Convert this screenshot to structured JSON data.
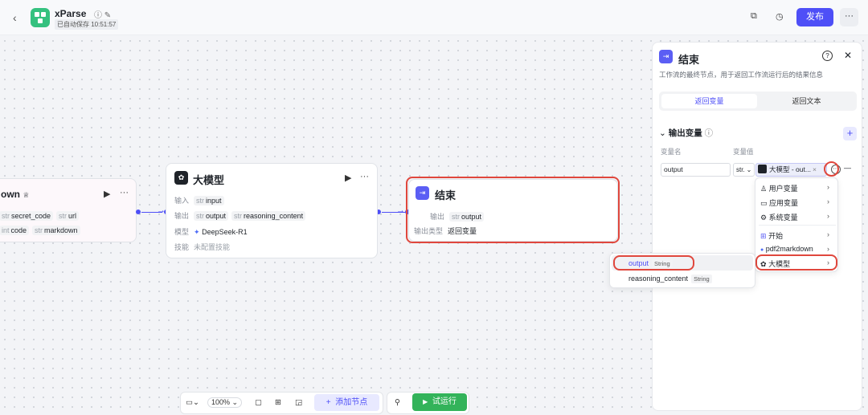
{
  "header": {
    "back_icon": "‹",
    "app_name": "xParse",
    "info_icon": "ⓘ",
    "edit_icon": "✎",
    "save_status": "已自动保存 10:51:57",
    "copy_icon": "⧉",
    "history_icon": "◷",
    "publish_label": "发布",
    "more_label": "···"
  },
  "canvas": {
    "node_left": {
      "title": "own",
      "title_icon": "♕",
      "run_icon": "▶",
      "more_icon": "···",
      "row1": [
        {
          "type": "str",
          "name": "secret_code"
        },
        {
          "type": "str",
          "name": "url"
        }
      ],
      "row2": [
        {
          "type": "int",
          "name": "code"
        },
        {
          "type": "str",
          "name": "markdown"
        }
      ]
    },
    "node_llm": {
      "title": "大模型",
      "run_icon": "▶",
      "more_icon": "···",
      "input_label": "输入",
      "input_type": "str",
      "input_name": "input",
      "output_label": "输出",
      "output1_type": "str",
      "output1_name": "output",
      "output2_type": "str",
      "output2_name": "reasoning_content",
      "model_label": "模型",
      "model_name": "DeepSeek-R1",
      "skill_label": "技能",
      "skill_value": "未配置技能"
    },
    "node_end": {
      "title": "结束",
      "output_label": "输出",
      "output_type": "str",
      "output_name": "output",
      "output_type_label": "输出类型",
      "output_type_value": "返回变量"
    }
  },
  "panel": {
    "title": "结束",
    "help_icon": "?",
    "close_icon": "✕",
    "description": "工作流的最终节点，用于返回工作流运行后的结果信息",
    "tab_active": "返回变量",
    "tab_other": "返回文本",
    "section_title": "输出变量",
    "section_info_icon": "ⓘ",
    "add_icon": "+",
    "col_name": "变量名",
    "col_value": "变量值",
    "var_name": "output",
    "var_type": "str.",
    "var_value": "大模型 - out...",
    "remove_icon": "—"
  },
  "var_menu": {
    "items": [
      {
        "label": "用户变量",
        "icon": "♙"
      },
      {
        "label": "应用变量",
        "icon": "▭"
      },
      {
        "label": "系统变量",
        "icon": "⚙"
      },
      {
        "label": "开始",
        "icon": "⊞"
      },
      {
        "label": "pdf2markdown",
        "icon": "●"
      },
      {
        "label": "大模型",
        "icon": "✿"
      }
    ],
    "submenu": [
      {
        "label": "output",
        "type": "String"
      },
      {
        "label": "reasoning_content",
        "type": "String"
      }
    ]
  },
  "bottom_toolbar": {
    "zoom": "100%",
    "add_node_label": "添加节点",
    "run_label": "试运行",
    "add_icon": "+",
    "play_icon": "▶"
  }
}
